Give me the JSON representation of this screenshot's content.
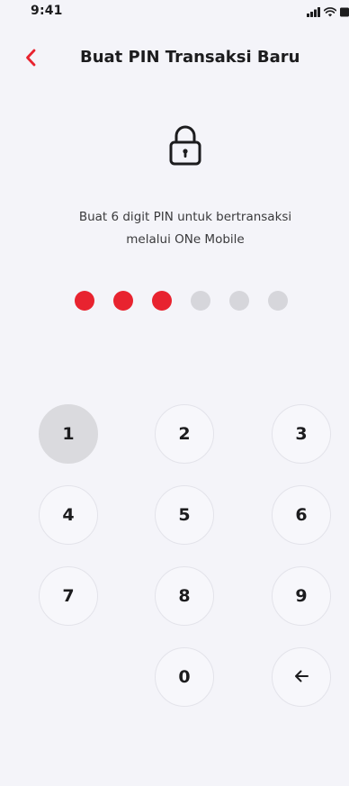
{
  "status_bar": {
    "time": "9:41",
    "icons": [
      "cellular-signal-icon",
      "wifi-icon",
      "battery-icon"
    ]
  },
  "header": {
    "back_icon": "chevron-left-icon",
    "title": "Buat PIN Transaksi Baru"
  },
  "main": {
    "lock_icon": "lock-icon",
    "instruction_line1": "Buat 6 digit PIN untuk bertransaksi",
    "instruction_line2": "melalui ONe Mobile",
    "pin": {
      "length": 6,
      "entered": 3
    }
  },
  "keypad": {
    "keys": [
      "1",
      "2",
      "3",
      "4",
      "5",
      "6",
      "7",
      "8",
      "9",
      "0"
    ],
    "pressed_key": "1",
    "delete_icon": "arrow-left-icon"
  },
  "colors": {
    "accent": "#e8232f",
    "background": "#f4f4f9",
    "dot_empty": "#d6d6db",
    "key_pressed": "#dadade"
  }
}
